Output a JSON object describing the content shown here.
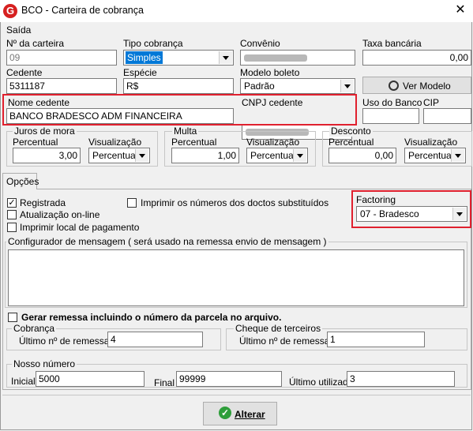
{
  "window": {
    "title": "BCO - Carteira de cobrança",
    "close_label": "✕"
  },
  "section_label": "Saída",
  "fields": {
    "num_carteira": {
      "label": "Nº da carteira",
      "value": "09"
    },
    "tipo_cobranca": {
      "label": "Tipo cobrança",
      "value": "Simples"
    },
    "convenio": {
      "label": "Convênio",
      "value": ""
    },
    "taxa_bancaria": {
      "label": "Taxa bancária",
      "value": "0,00"
    },
    "cedente": {
      "label": "Cedente",
      "value": "5311187"
    },
    "especie": {
      "label": "Espécie",
      "value": "R$"
    },
    "modelo_boleto": {
      "label": "Modelo boleto",
      "value": "Padrão"
    },
    "ver_modelo": {
      "label": "Ver Modelo"
    },
    "nome_cedente": {
      "label": "Nome cedente",
      "value": "BANCO BRADESCO ADM FINANCEIRA"
    },
    "cnpj_cedente": {
      "label": "CNPJ cedente",
      "value": ""
    },
    "uso_banco": {
      "label": "Uso do Banco",
      "value": ""
    },
    "cip": {
      "label": "CIP",
      "value": ""
    }
  },
  "juros": {
    "title": "Juros de mora",
    "percentual_label": "Percentual",
    "percentual": "3,00",
    "visualizacao_label": "Visualização",
    "visualizacao": "Percentual"
  },
  "multa": {
    "title": "Multa",
    "percentual_label": "Percentual",
    "percentual": "1,00",
    "visualizacao_label": "Visualização",
    "visualizacao": "Percentual"
  },
  "desconto": {
    "title": "Desconto",
    "percentual_label": "Percentual",
    "percentual": "0,00",
    "visualizacao_label": "Visualização",
    "visualizacao": "Percentual"
  },
  "tabs": {
    "opcoes": "Opções"
  },
  "options": {
    "registrada": {
      "label": "Registrada",
      "checked": true
    },
    "atualizacao": {
      "label": "Atualização on-line",
      "checked": false
    },
    "imprimir_local": {
      "label": "Imprimir local de pagamento",
      "checked": false
    },
    "imprimir_numeros": {
      "label": "Imprimir os números dos doctos substituídos",
      "checked": false
    }
  },
  "factoring": {
    "label": "Factoring",
    "value": "07 - Bradesco"
  },
  "mensagem": {
    "label": "Configurador de mensagem ( será usado na remessa envio de mensagem )",
    "value": ""
  },
  "gerar_remessa": {
    "label": "Gerar remessa incluindo o número da parcela no arquivo.",
    "checked": false
  },
  "cobranca": {
    "title": "Cobrança",
    "ultimo_label": "Último nº  de remessa",
    "ultimo": "4"
  },
  "cheque": {
    "title": "Cheque de terceiros",
    "ultimo_label": "Último nº  de remessa",
    "ultimo": "1"
  },
  "nosso_numero": {
    "title": "Nosso número",
    "inicial_label": "Inicial",
    "inicial": "5000",
    "final_label": "Final",
    "final": "99999",
    "ultimo_label": "Último utilizado",
    "ultimo": "3"
  },
  "alterar": {
    "label": "Alterar"
  },
  "colors": {
    "highlight": "#e0202e",
    "selection": "#0078d7"
  }
}
